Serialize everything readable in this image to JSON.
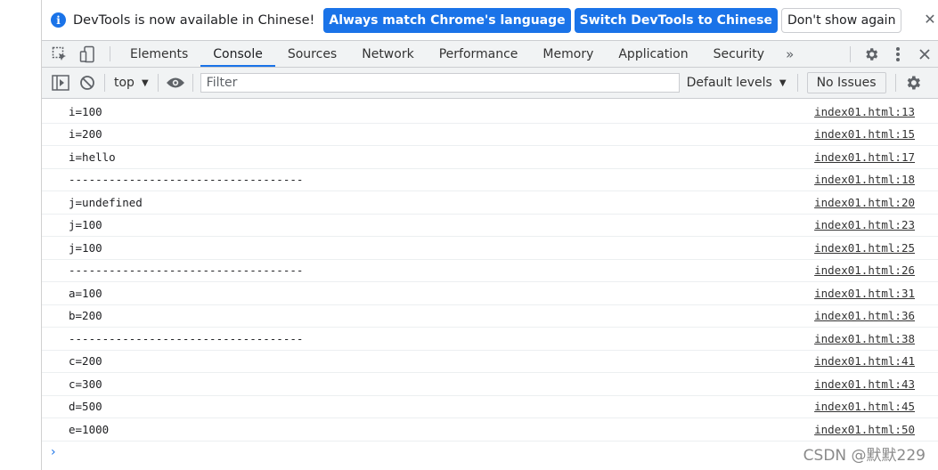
{
  "infobar": {
    "message": "DevTools is now available in Chinese!",
    "match_button": "Always match Chrome's language",
    "switch_button": "Switch DevTools to Chinese",
    "dismiss_button": "Don't show again",
    "close_glyph": "✕"
  },
  "tabs": [
    {
      "label": "Elements"
    },
    {
      "label": "Console",
      "active": true
    },
    {
      "label": "Sources"
    },
    {
      "label": "Network"
    },
    {
      "label": "Performance"
    },
    {
      "label": "Memory"
    },
    {
      "label": "Application"
    },
    {
      "label": "Security"
    }
  ],
  "tabs_overflow": "»",
  "console_toolbar": {
    "context": "top",
    "filter_placeholder": "Filter",
    "levels": "Default levels",
    "issues": "No Issues"
  },
  "messages": [
    {
      "text": "i=100",
      "source": "index01.html:13"
    },
    {
      "text": "i=200",
      "source": "index01.html:15"
    },
    {
      "text": "i=hello",
      "source": "index01.html:17"
    },
    {
      "text": "-----------------------------------",
      "source": "index01.html:18"
    },
    {
      "text": "j=undefined",
      "source": "index01.html:20"
    },
    {
      "text": "j=100",
      "source": "index01.html:23"
    },
    {
      "text": "j=100",
      "source": "index01.html:25"
    },
    {
      "text": "-----------------------------------",
      "source": "index01.html:26"
    },
    {
      "text": "a=100",
      "source": "index01.html:31"
    },
    {
      "text": "b=200",
      "source": "index01.html:36"
    },
    {
      "text": "-----------------------------------",
      "source": "index01.html:38"
    },
    {
      "text": "c=200",
      "source": "index01.html:41"
    },
    {
      "text": "c=300",
      "source": "index01.html:43"
    },
    {
      "text": "d=500",
      "source": "index01.html:45"
    },
    {
      "text": "e=1000",
      "source": "index01.html:50"
    }
  ],
  "prompt_glyph": "›",
  "watermark": "CSDN @默默229",
  "colors": {
    "accent": "#1a73e8",
    "toolbar_bg": "#f1f3f4",
    "border": "#cbcdd1"
  }
}
